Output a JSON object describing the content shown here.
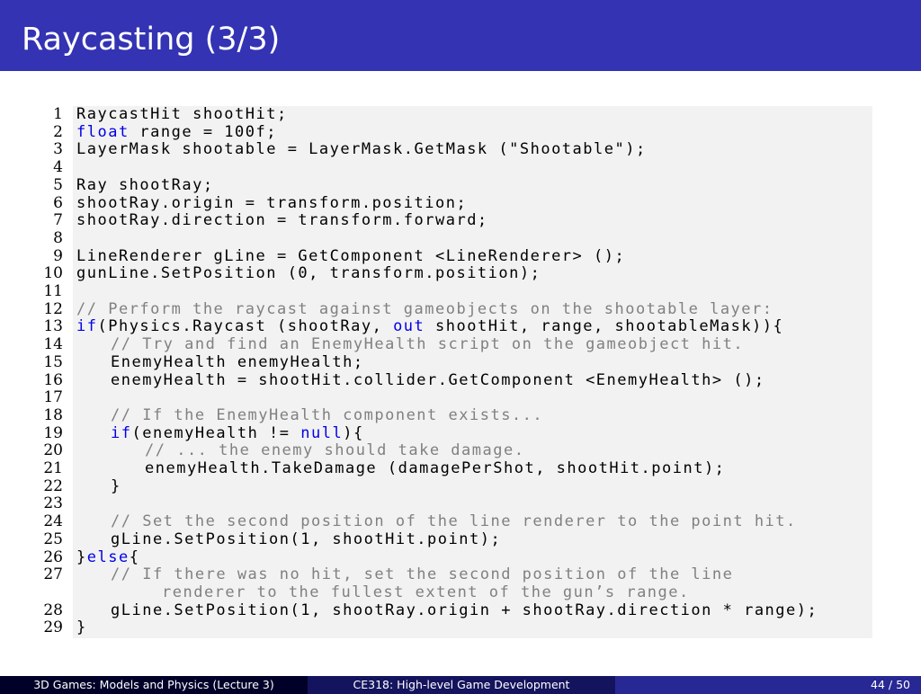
{
  "slide": {
    "title": "Raycasting (3/3)"
  },
  "code": {
    "lines": [
      {
        "n": "1",
        "indent": 0,
        "wrap": false,
        "tokens": [
          [
            "normal",
            "RaycastHit shootHit;"
          ]
        ]
      },
      {
        "n": "2",
        "indent": 0,
        "wrap": false,
        "tokens": [
          [
            "keyword",
            "float"
          ],
          [
            "normal",
            " range = 100f;"
          ]
        ]
      },
      {
        "n": "3",
        "indent": 0,
        "wrap": false,
        "tokens": [
          [
            "normal",
            "LayerMask shootable = LayerMask.GetMask (\"Shootable\");"
          ]
        ]
      },
      {
        "n": "4",
        "indent": 0,
        "wrap": false,
        "tokens": []
      },
      {
        "n": "5",
        "indent": 0,
        "wrap": false,
        "tokens": [
          [
            "normal",
            "Ray shootRay;"
          ]
        ]
      },
      {
        "n": "6",
        "indent": 0,
        "wrap": false,
        "tokens": [
          [
            "normal",
            "shootRay.origin = transform.position;"
          ]
        ]
      },
      {
        "n": "7",
        "indent": 0,
        "wrap": false,
        "tokens": [
          [
            "normal",
            "shootRay.direction = transform.forward;"
          ]
        ]
      },
      {
        "n": "8",
        "indent": 0,
        "wrap": false,
        "tokens": []
      },
      {
        "n": "9",
        "indent": 0,
        "wrap": false,
        "tokens": [
          [
            "normal",
            "LineRenderer gLine = GetComponent <LineRenderer> ();"
          ]
        ]
      },
      {
        "n": "10",
        "indent": 0,
        "wrap": false,
        "tokens": [
          [
            "normal",
            "gunLine.SetPosition (0, transform.position);"
          ]
        ]
      },
      {
        "n": "11",
        "indent": 0,
        "wrap": false,
        "tokens": []
      },
      {
        "n": "12",
        "indent": 0,
        "wrap": false,
        "tokens": [
          [
            "comment",
            "// Perform the raycast against gameobjects on the shootable layer:"
          ]
        ]
      },
      {
        "n": "13",
        "indent": 0,
        "wrap": false,
        "tokens": [
          [
            "keyword",
            "if"
          ],
          [
            "normal",
            "(Physics.Raycast (shootRay, "
          ],
          [
            "keyword",
            "out"
          ],
          [
            "normal",
            " shootHit, range, shootableMask)){"
          ]
        ]
      },
      {
        "n": "14",
        "indent": 1,
        "wrap": false,
        "tokens": [
          [
            "comment",
            "// Try and find an EnemyHealth script on the gameobject hit."
          ]
        ]
      },
      {
        "n": "15",
        "indent": 1,
        "wrap": false,
        "tokens": [
          [
            "normal",
            "EnemyHealth enemyHealth;"
          ]
        ]
      },
      {
        "n": "16",
        "indent": 1,
        "wrap": false,
        "tokens": [
          [
            "normal",
            "enemyHealth = shootHit.collider.GetComponent <EnemyHealth> ();"
          ]
        ]
      },
      {
        "n": "17",
        "indent": 0,
        "wrap": false,
        "tokens": []
      },
      {
        "n": "18",
        "indent": 1,
        "wrap": false,
        "tokens": [
          [
            "comment",
            "// If the EnemyHealth component exists..."
          ]
        ]
      },
      {
        "n": "19",
        "indent": 1,
        "wrap": false,
        "tokens": [
          [
            "keyword",
            "if"
          ],
          [
            "normal",
            "(enemyHealth != "
          ],
          [
            "keyword",
            "null"
          ],
          [
            "normal",
            "){"
          ]
        ]
      },
      {
        "n": "20",
        "indent": 2,
        "wrap": false,
        "tokens": [
          [
            "comment",
            "// ... the enemy should take damage."
          ]
        ]
      },
      {
        "n": "21",
        "indent": 2,
        "wrap": false,
        "tokens": [
          [
            "normal",
            "enemyHealth.TakeDamage (damagePerShot, shootHit.point);"
          ]
        ]
      },
      {
        "n": "22",
        "indent": 1,
        "wrap": false,
        "tokens": [
          [
            "normal",
            "}"
          ]
        ]
      },
      {
        "n": "23",
        "indent": 0,
        "wrap": false,
        "tokens": []
      },
      {
        "n": "24",
        "indent": 1,
        "wrap": false,
        "tokens": [
          [
            "comment",
            "// Set the second position of the line renderer to the point hit."
          ]
        ]
      },
      {
        "n": "25",
        "indent": 1,
        "wrap": false,
        "tokens": [
          [
            "normal",
            "gLine.SetPosition(1, shootHit.point);"
          ]
        ]
      },
      {
        "n": "26",
        "indent": 0,
        "wrap": false,
        "tokens": [
          [
            "normal",
            "}"
          ],
          [
            "keyword",
            "else"
          ],
          [
            "normal",
            "{"
          ]
        ]
      },
      {
        "n": "27",
        "indent": 1,
        "wrap": false,
        "tokens": [
          [
            "comment",
            "// If there was no hit, set the second position of the line"
          ]
        ]
      },
      {
        "n": "",
        "indent": 1,
        "wrap": true,
        "tokens": [
          [
            "comment",
            "renderer to the fullest extent of the gun’s range."
          ]
        ]
      },
      {
        "n": "28",
        "indent": 1,
        "wrap": false,
        "tokens": [
          [
            "normal",
            "gLine.SetPosition(1, shootRay.origin + shootRay.direction * range);"
          ]
        ]
      },
      {
        "n": "29",
        "indent": 0,
        "wrap": false,
        "tokens": [
          [
            "normal",
            "}"
          ]
        ]
      }
    ]
  },
  "footer": {
    "lecture": "3D Games: Models and Physics  (Lecture 3)",
    "course": "CE318: High-level Game Development",
    "page": "44 / 50"
  },
  "colors": {
    "title_bar": "#3333b3",
    "keyword": "#0000e6",
    "comment": "#808080",
    "code_bg": "#f2f2f2"
  }
}
